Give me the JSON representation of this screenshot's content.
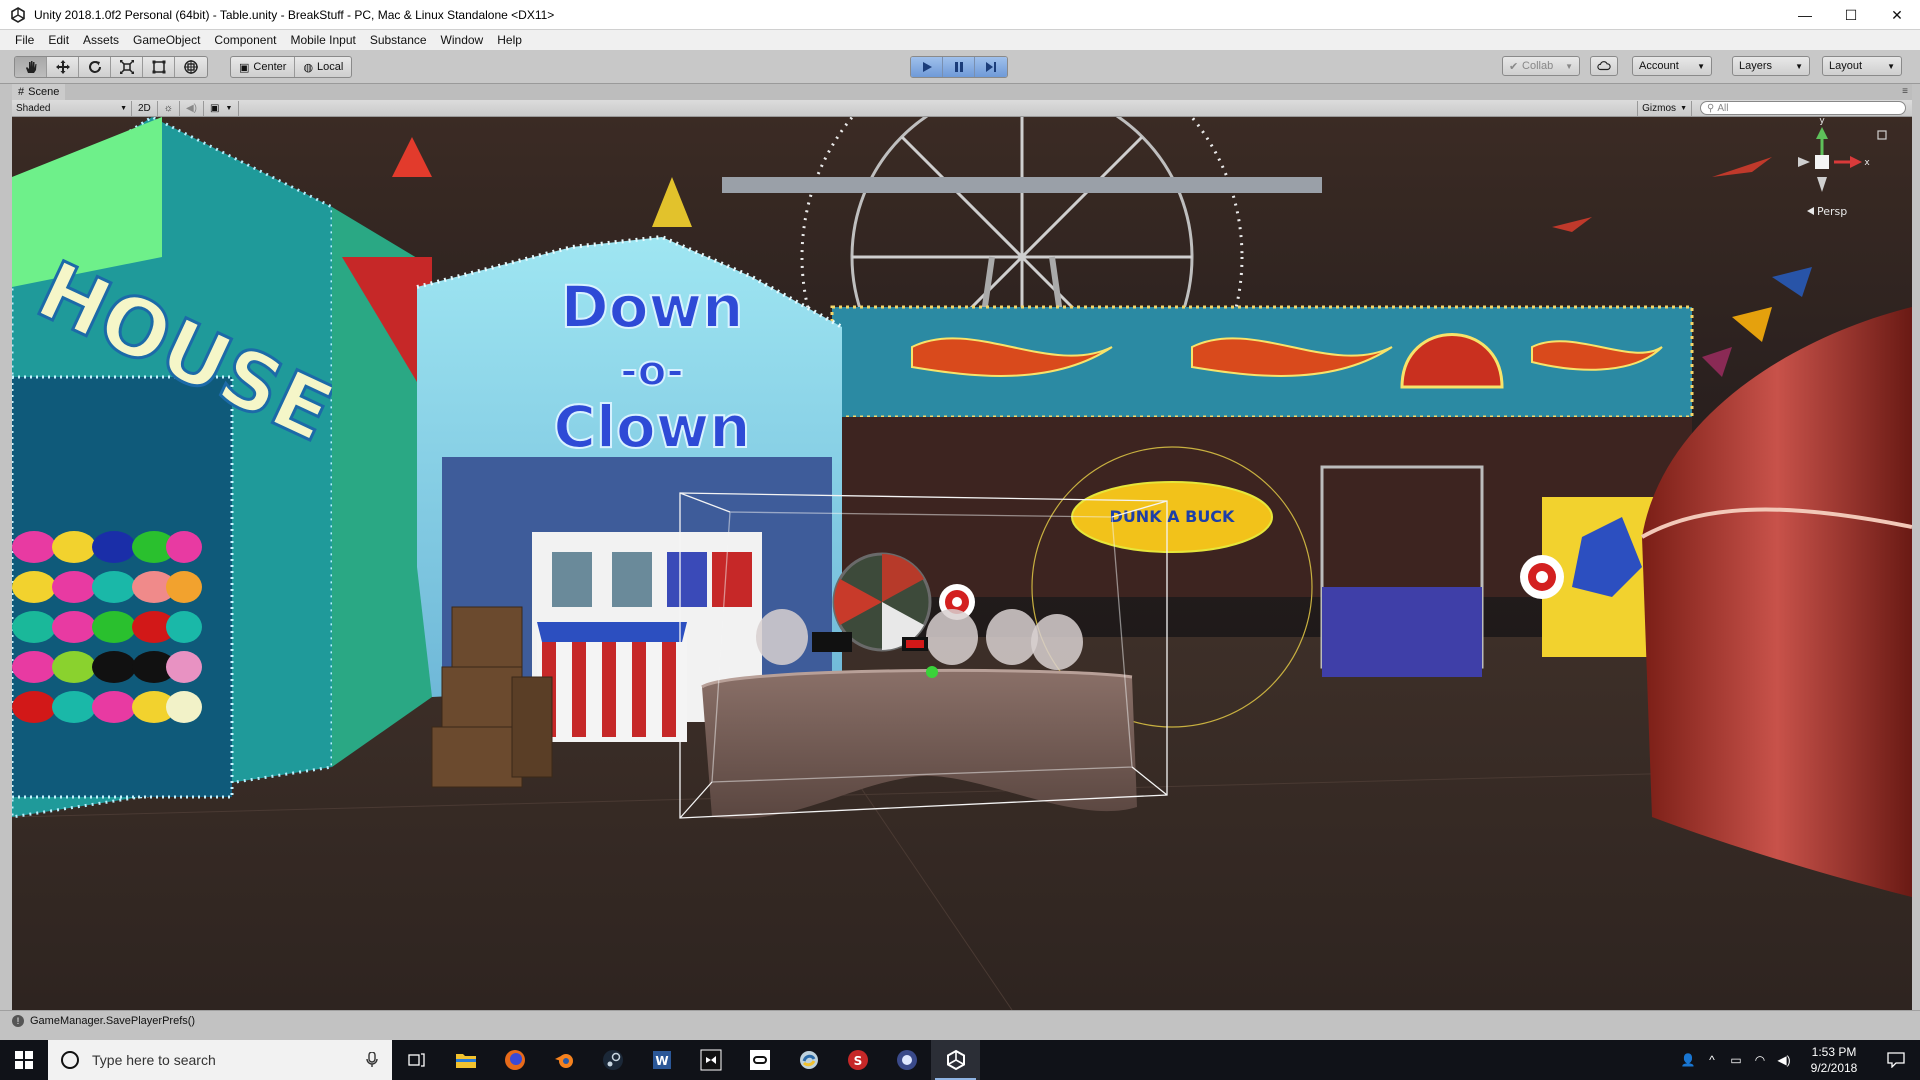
{
  "window": {
    "title": "Unity 2018.1.0f2 Personal (64bit) - Table.unity - BreakStuff - PC, Mac & Linux Standalone <DX11>",
    "controls": [
      "minimize",
      "maximize",
      "close"
    ]
  },
  "menu": {
    "items": [
      "File",
      "Edit",
      "Assets",
      "GameObject",
      "Component",
      "Mobile Input",
      "Substance",
      "Window",
      "Help"
    ]
  },
  "toolbar": {
    "tools": [
      "hand-tool",
      "move-tool",
      "rotate-tool",
      "scale-tool",
      "rect-tool",
      "transform-tool"
    ],
    "pivot_label": "Center",
    "space_label": "Local",
    "collab_label": "Collab",
    "account_label": "Account",
    "layers_label": "Layers",
    "layout_label": "Layout"
  },
  "scene": {
    "tab_label": "Scene",
    "shading_mode": "Shaded",
    "mode_2d_label": "2D",
    "gizmos_label": "Gizmos",
    "search_placeholder": "All",
    "projection_label": "Persp",
    "axis_y_label": "y",
    "axis_x_label": "x"
  },
  "signs": {
    "booth_line1": "Down",
    "booth_line2": "-o-",
    "booth_line3": "Clown",
    "house_text": "HOUSE",
    "dunk_text": "DUNK A BUCK"
  },
  "status": {
    "message": "GameManager.SavePlayerPrefs()"
  },
  "taskbar": {
    "search_placeholder": "Type here to search",
    "apps": [
      "task-view",
      "file-explorer",
      "firefox",
      "blender",
      "steam",
      "word",
      "visual-studio",
      "oculus",
      "python",
      "substance",
      "vpn",
      "unity"
    ],
    "time": "1:53 PM",
    "date": "9/2/2018"
  },
  "colors": {
    "titlebar_bg": "#ffffff",
    "editor_bg": "#c2c2c2",
    "play_blue": "#6f9ad8",
    "taskbar_bg": "#101218",
    "sky": "#2e2320",
    "ground": "#3a2c26"
  }
}
